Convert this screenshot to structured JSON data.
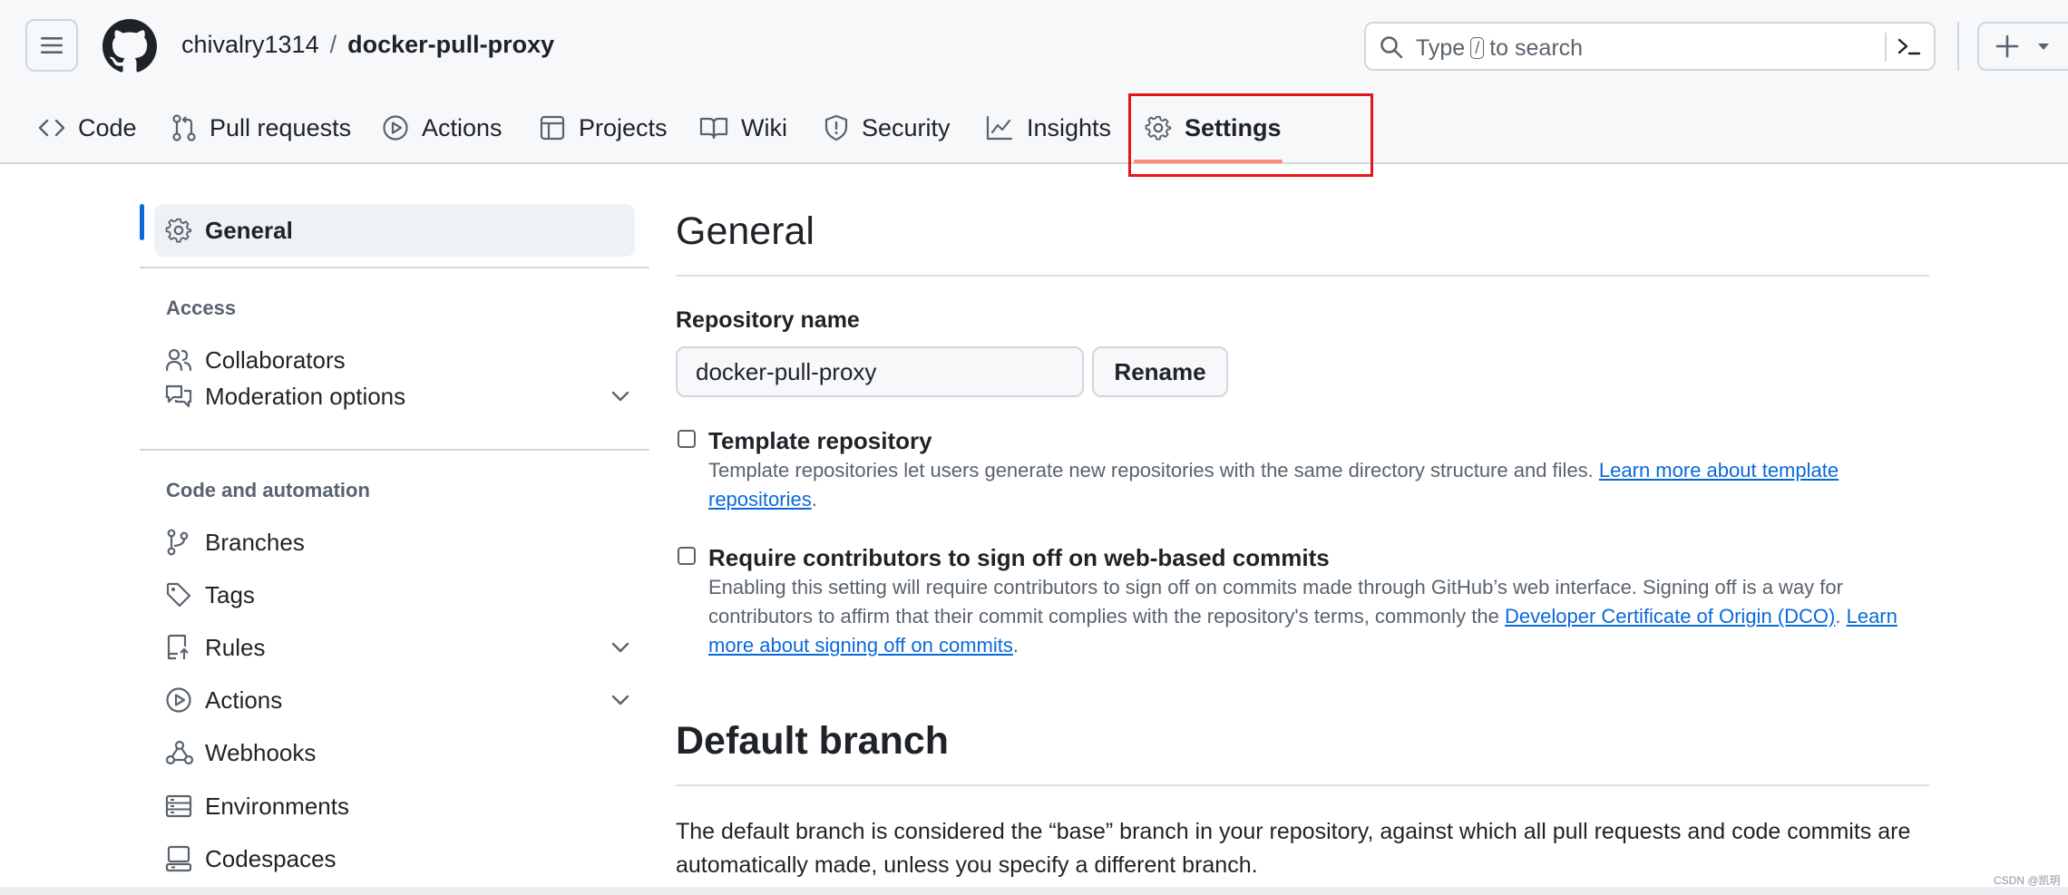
{
  "header": {
    "owner": "chivalry1314",
    "separator": "/",
    "repo": "docker-pull-proxy",
    "search": {
      "prefix": "Type",
      "key": "/",
      "suffix": "to search"
    }
  },
  "tabs": [
    {
      "label": "Code",
      "icon": "code-icon"
    },
    {
      "label": "Pull requests",
      "icon": "pull-request-icon"
    },
    {
      "label": "Actions",
      "icon": "play-icon"
    },
    {
      "label": "Projects",
      "icon": "table-icon"
    },
    {
      "label": "Wiki",
      "icon": "book-icon"
    },
    {
      "label": "Security",
      "icon": "shield-icon"
    },
    {
      "label": "Insights",
      "icon": "graph-icon"
    },
    {
      "label": "Settings",
      "icon": "gear-icon",
      "selected": true
    }
  ],
  "sidebar": {
    "general": "General",
    "access_heading": "Access",
    "collaborators": "Collaborators",
    "moderation": "Moderation options",
    "code_heading": "Code and automation",
    "branches": "Branches",
    "tags": "Tags",
    "rules": "Rules",
    "actions": "Actions",
    "webhooks": "Webhooks",
    "environments": "Environments",
    "codespaces": "Codespaces"
  },
  "main": {
    "title": "General",
    "repo_name_label": "Repository name",
    "repo_name_value": "docker-pull-proxy",
    "rename_button": "Rename",
    "template": {
      "title": "Template repository",
      "desc": "Template repositories let users generate new repositories with the same directory structure and files.",
      "link": "Learn more about template repositories",
      "end": "."
    },
    "signoff": {
      "title": "Require contributors to sign off on web-based commits",
      "desc": "Enabling this setting will require contributors to sign off on commits made through GitHub’s web interface. Signing off is a way for contributors to affirm that their commit complies with the repository's terms, commonly the",
      "link1": "Developer Certificate of Origin (DCO)",
      "mid": ".",
      "link2": "Learn more about signing off on commits",
      "end": "."
    },
    "default_branch_title": "Default branch",
    "default_branch_desc": "The default branch is considered the “base” branch in your repository, against which all pull requests and code commits are automatically made, unless you specify a different branch."
  },
  "watermark": "CSDN @凯玥",
  "colors": {
    "accent": "#0969da",
    "tab_underline": "#fd8c73",
    "annotation": "#e5141d"
  }
}
